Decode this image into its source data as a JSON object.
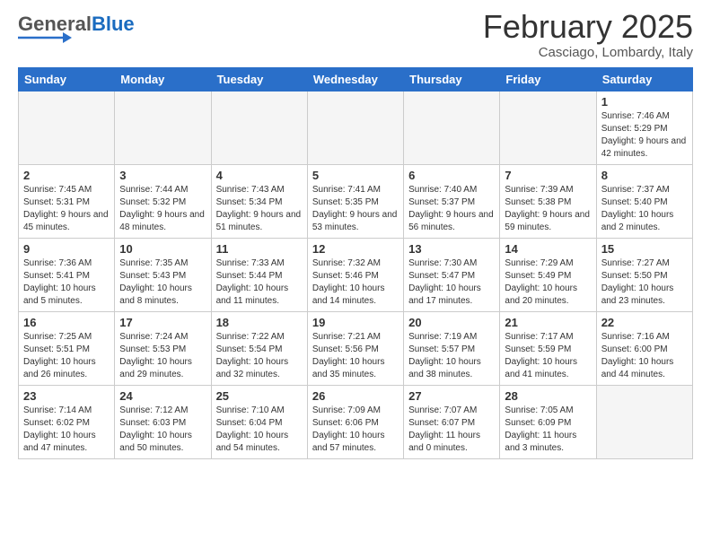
{
  "header": {
    "logo_general": "General",
    "logo_blue": "Blue",
    "month_title": "February 2025",
    "location": "Casciago, Lombardy, Italy"
  },
  "weekdays": [
    "Sunday",
    "Monday",
    "Tuesday",
    "Wednesday",
    "Thursday",
    "Friday",
    "Saturday"
  ],
  "weeks": [
    [
      {
        "day": "",
        "info": "",
        "empty": true
      },
      {
        "day": "",
        "info": "",
        "empty": true
      },
      {
        "day": "",
        "info": "",
        "empty": true
      },
      {
        "day": "",
        "info": "",
        "empty": true
      },
      {
        "day": "",
        "info": "",
        "empty": true
      },
      {
        "day": "",
        "info": "",
        "empty": true
      },
      {
        "day": "1",
        "info": "Sunrise: 7:46 AM\nSunset: 5:29 PM\nDaylight: 9 hours and 42 minutes."
      }
    ],
    [
      {
        "day": "2",
        "info": "Sunrise: 7:45 AM\nSunset: 5:31 PM\nDaylight: 9 hours and 45 minutes."
      },
      {
        "day": "3",
        "info": "Sunrise: 7:44 AM\nSunset: 5:32 PM\nDaylight: 9 hours and 48 minutes."
      },
      {
        "day": "4",
        "info": "Sunrise: 7:43 AM\nSunset: 5:34 PM\nDaylight: 9 hours and 51 minutes."
      },
      {
        "day": "5",
        "info": "Sunrise: 7:41 AM\nSunset: 5:35 PM\nDaylight: 9 hours and 53 minutes."
      },
      {
        "day": "6",
        "info": "Sunrise: 7:40 AM\nSunset: 5:37 PM\nDaylight: 9 hours and 56 minutes."
      },
      {
        "day": "7",
        "info": "Sunrise: 7:39 AM\nSunset: 5:38 PM\nDaylight: 9 hours and 59 minutes."
      },
      {
        "day": "8",
        "info": "Sunrise: 7:37 AM\nSunset: 5:40 PM\nDaylight: 10 hours and 2 minutes."
      }
    ],
    [
      {
        "day": "9",
        "info": "Sunrise: 7:36 AM\nSunset: 5:41 PM\nDaylight: 10 hours and 5 minutes."
      },
      {
        "day": "10",
        "info": "Sunrise: 7:35 AM\nSunset: 5:43 PM\nDaylight: 10 hours and 8 minutes."
      },
      {
        "day": "11",
        "info": "Sunrise: 7:33 AM\nSunset: 5:44 PM\nDaylight: 10 hours and 11 minutes."
      },
      {
        "day": "12",
        "info": "Sunrise: 7:32 AM\nSunset: 5:46 PM\nDaylight: 10 hours and 14 minutes."
      },
      {
        "day": "13",
        "info": "Sunrise: 7:30 AM\nSunset: 5:47 PM\nDaylight: 10 hours and 17 minutes."
      },
      {
        "day": "14",
        "info": "Sunrise: 7:29 AM\nSunset: 5:49 PM\nDaylight: 10 hours and 20 minutes."
      },
      {
        "day": "15",
        "info": "Sunrise: 7:27 AM\nSunset: 5:50 PM\nDaylight: 10 hours and 23 minutes."
      }
    ],
    [
      {
        "day": "16",
        "info": "Sunrise: 7:25 AM\nSunset: 5:51 PM\nDaylight: 10 hours and 26 minutes."
      },
      {
        "day": "17",
        "info": "Sunrise: 7:24 AM\nSunset: 5:53 PM\nDaylight: 10 hours and 29 minutes."
      },
      {
        "day": "18",
        "info": "Sunrise: 7:22 AM\nSunset: 5:54 PM\nDaylight: 10 hours and 32 minutes."
      },
      {
        "day": "19",
        "info": "Sunrise: 7:21 AM\nSunset: 5:56 PM\nDaylight: 10 hours and 35 minutes."
      },
      {
        "day": "20",
        "info": "Sunrise: 7:19 AM\nSunset: 5:57 PM\nDaylight: 10 hours and 38 minutes."
      },
      {
        "day": "21",
        "info": "Sunrise: 7:17 AM\nSunset: 5:59 PM\nDaylight: 10 hours and 41 minutes."
      },
      {
        "day": "22",
        "info": "Sunrise: 7:16 AM\nSunset: 6:00 PM\nDaylight: 10 hours and 44 minutes."
      }
    ],
    [
      {
        "day": "23",
        "info": "Sunrise: 7:14 AM\nSunset: 6:02 PM\nDaylight: 10 hours and 47 minutes."
      },
      {
        "day": "24",
        "info": "Sunrise: 7:12 AM\nSunset: 6:03 PM\nDaylight: 10 hours and 50 minutes."
      },
      {
        "day": "25",
        "info": "Sunrise: 7:10 AM\nSunset: 6:04 PM\nDaylight: 10 hours and 54 minutes."
      },
      {
        "day": "26",
        "info": "Sunrise: 7:09 AM\nSunset: 6:06 PM\nDaylight: 10 hours and 57 minutes."
      },
      {
        "day": "27",
        "info": "Sunrise: 7:07 AM\nSunset: 6:07 PM\nDaylight: 11 hours and 0 minutes."
      },
      {
        "day": "28",
        "info": "Sunrise: 7:05 AM\nSunset: 6:09 PM\nDaylight: 11 hours and 3 minutes."
      },
      {
        "day": "",
        "info": "",
        "empty": true
      }
    ]
  ]
}
